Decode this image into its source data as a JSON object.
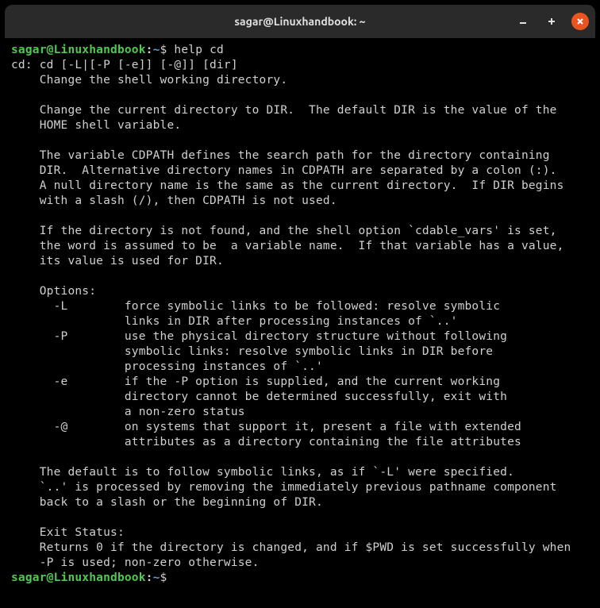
{
  "titlebar": {
    "title": "sagar@Linuxhandbook: ~"
  },
  "prompt": {
    "user_host": "sagar@Linuxhandbook",
    "colon": ":",
    "path": "~",
    "dollar": "$"
  },
  "command1": "help cd",
  "output_lines": [
    "cd: cd [-L|[-P [-e]] [-@]] [dir]",
    "    Change the shell working directory.",
    "    ",
    "    Change the current directory to DIR.  The default DIR is the value of the",
    "    HOME shell variable.",
    "    ",
    "    The variable CDPATH defines the search path for the directory containing",
    "    DIR.  Alternative directory names in CDPATH are separated by a colon (:).",
    "    A null directory name is the same as the current directory.  If DIR begins",
    "    with a slash (/), then CDPATH is not used.",
    "    ",
    "    If the directory is not found, and the shell option `cdable_vars' is set,",
    "    the word is assumed to be  a variable name.  If that variable has a value,",
    "    its value is used for DIR.",
    "    ",
    "    Options:",
    "      -L        force symbolic links to be followed: resolve symbolic",
    "                links in DIR after processing instances of `..'",
    "      -P        use the physical directory structure without following",
    "                symbolic links: resolve symbolic links in DIR before",
    "                processing instances of `..'",
    "      -e        if the -P option is supplied, and the current working",
    "                directory cannot be determined successfully, exit with",
    "                a non-zero status",
    "      -@        on systems that support it, present a file with extended",
    "                attributes as a directory containing the file attributes",
    "    ",
    "    The default is to follow symbolic links, as if `-L' were specified.",
    "    `..' is processed by removing the immediately previous pathname component",
    "    back to a slash or the beginning of DIR.",
    "    ",
    "    Exit Status:",
    "    Returns 0 if the directory is changed, and if $PWD is set successfully when",
    "    -P is used; non-zero otherwise."
  ],
  "command2": ""
}
